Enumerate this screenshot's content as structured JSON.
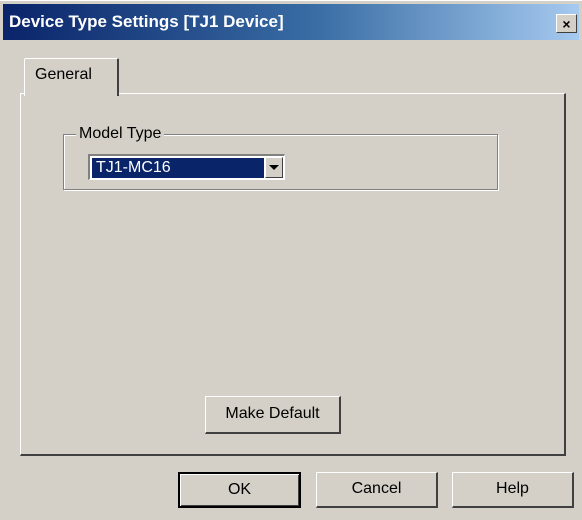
{
  "window": {
    "title": "Device Type Settings [TJ1 Device]",
    "close_glyph": "×"
  },
  "tabs": [
    {
      "label": "General",
      "active": true
    }
  ],
  "general": {
    "model_type_group_label": "Model Type",
    "model_type_value": "TJ1-MC16",
    "make_default_label": "Make Default"
  },
  "buttons": {
    "ok_label": "OK",
    "cancel_label": "Cancel",
    "help_label": "Help"
  },
  "colors": {
    "titlebar_start": "#0a246a",
    "titlebar_end": "#a6caf0",
    "face": "#d4d0c8",
    "selection": "#0a246a"
  }
}
